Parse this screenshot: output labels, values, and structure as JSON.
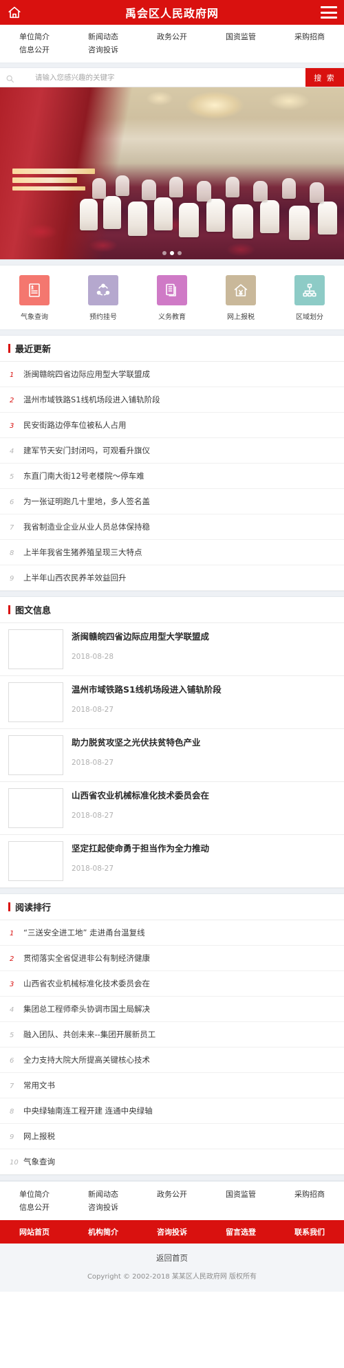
{
  "header": {
    "title": "禹会区人民政府网",
    "home_icon": "home-icon",
    "menu_icon": "hamburger-menu-icon",
    "brand_color": "#d9110f"
  },
  "topnav": {
    "items": [
      {
        "label": "单位简介"
      },
      {
        "label": "新闻动态"
      },
      {
        "label": "政务公开"
      },
      {
        "label": "国资监管"
      },
      {
        "label": "采购招商"
      },
      {
        "label": "信息公开"
      },
      {
        "label": "咨询投诉"
      }
    ]
  },
  "search": {
    "placeholder": "请输入您感兴趣的关键字",
    "value": "",
    "button_label": "搜 索",
    "icon": "search-icon"
  },
  "banner": {
    "slide_count": 3,
    "active_index": 1,
    "alt": "会议大厅宣传图"
  },
  "quicklinks": [
    {
      "label": "气象查询",
      "icon": "weather-report-icon",
      "color": "#f4776f"
    },
    {
      "label": "预约挂号",
      "icon": "appointment-registration-icon",
      "color": "#b5a8ce"
    },
    {
      "label": "义务教育",
      "icon": "documents-icon",
      "color": "#cf7ac6"
    },
    {
      "label": "网上报税",
      "icon": "tax-house-icon",
      "color": "#c9b89a"
    },
    {
      "label": "区域划分",
      "icon": "sitemap-icon",
      "color": "#8dcbc6"
    }
  ],
  "recent_updates": {
    "title": "最近更新",
    "items": [
      {
        "rank": "1",
        "title": "浙闽赣皖四省边际应用型大学联盟成"
      },
      {
        "rank": "2",
        "title": "温州市域铁路S1线机场段进入铺轨阶段"
      },
      {
        "rank": "3",
        "title": "民安街路边停车位被私人占用"
      },
      {
        "rank": "4",
        "title": "建军节天安门封闭吗，可观看升旗仪"
      },
      {
        "rank": "5",
        "title": "东直门南大街12号老楼院～停车难"
      },
      {
        "rank": "6",
        "title": "为一张证明跑几十里地，多人签名盖"
      },
      {
        "rank": "7",
        "title": "我省制造业企业从业人员总体保持稳"
      },
      {
        "rank": "8",
        "title": "上半年我省生猪养殖呈现三大特点"
      },
      {
        "rank": "9",
        "title": "上半年山西农民养羊效益回升"
      }
    ]
  },
  "pic_news": {
    "title": "图文信息",
    "items": [
      {
        "title": "浙闽赣皖四省边际应用型大学联盟成",
        "date": "2018-08-28",
        "thumb": "t1"
      },
      {
        "title": "温州市域铁路S1线机场段进入铺轨阶段",
        "date": "2018-08-27",
        "thumb": "t2"
      },
      {
        "title": "助力脱贫攻坚之光伏扶贫特色产业",
        "date": "2018-08-27",
        "thumb": "t3"
      },
      {
        "title": "山西省农业机械标准化技术委员会在",
        "date": "2018-08-27",
        "thumb": "t4"
      },
      {
        "title": "坚定扛起使命勇于担当作为全力推动",
        "date": "2018-08-27",
        "thumb": "t5"
      }
    ]
  },
  "reading_rank": {
    "title": "阅读排行",
    "items": [
      {
        "rank": "1",
        "title": "“三送安全进工地” 走进甬台温复线"
      },
      {
        "rank": "2",
        "title": "贯彻落实全省促进非公有制经济健康"
      },
      {
        "rank": "3",
        "title": "山西省农业机械标准化技术委员会在"
      },
      {
        "rank": "4",
        "title": "集团总工程师牵头协调市国土局解决"
      },
      {
        "rank": "5",
        "title": "融入团队、共创未来--集团开展新员工"
      },
      {
        "rank": "6",
        "title": "全力支持大院大所提高关键核心技术"
      },
      {
        "rank": "7",
        "title": "常用文书"
      },
      {
        "rank": "8",
        "title": "中央绿轴南连工程开建 连通中央绿轴"
      },
      {
        "rank": "9",
        "title": "网上报税"
      },
      {
        "rank": "10",
        "title": "气象查询"
      }
    ]
  },
  "footer_nav": {
    "items": [
      {
        "label": "单位简介"
      },
      {
        "label": "新闻动态"
      },
      {
        "label": "政务公开"
      },
      {
        "label": "国资监管"
      },
      {
        "label": "采购招商"
      },
      {
        "label": "信息公开"
      },
      {
        "label": "咨询投诉"
      }
    ]
  },
  "footer_red": {
    "items": [
      {
        "label": "网站首页"
      },
      {
        "label": "机构简介"
      },
      {
        "label": "咨询投诉"
      },
      {
        "label": "留言选登"
      },
      {
        "label": "联系我们"
      }
    ]
  },
  "footer_bottom": {
    "back_home": "返回首页",
    "copyright": "Copyright © 2002-2018 某某区人民政府网 版权所有"
  }
}
